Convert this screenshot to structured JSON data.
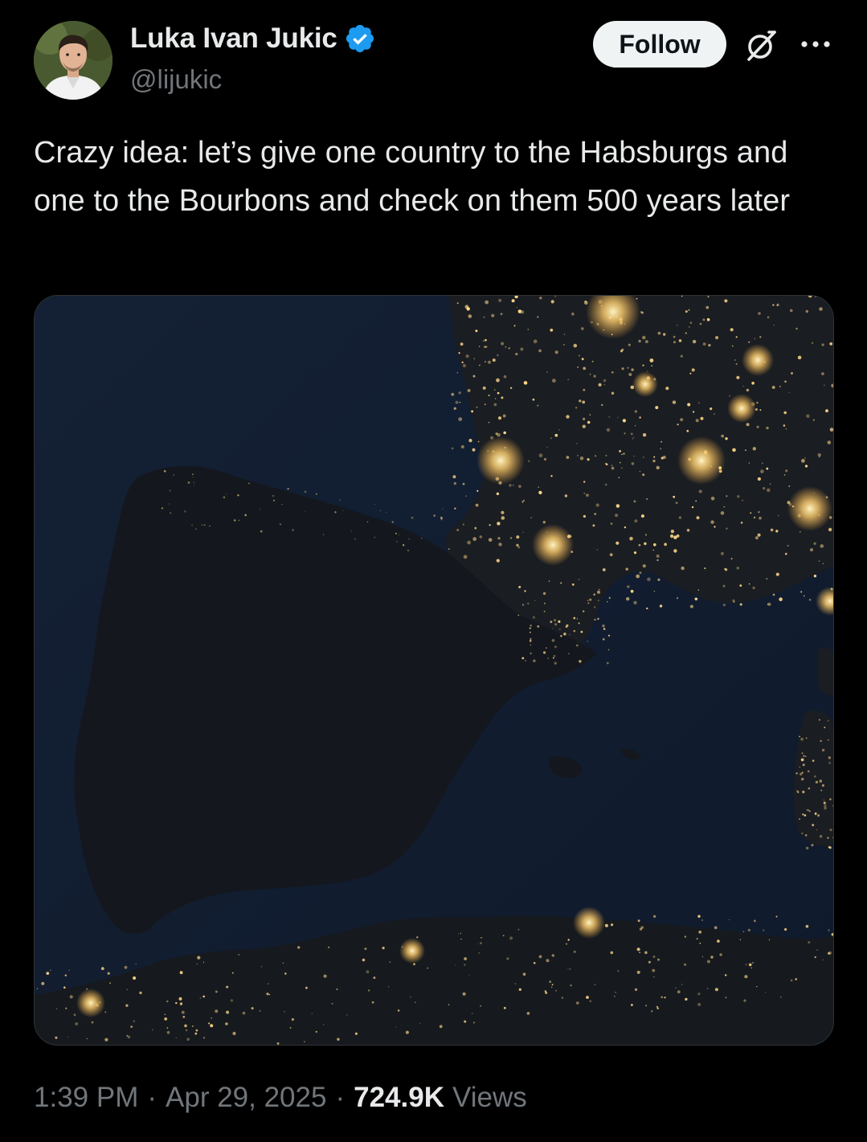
{
  "author": {
    "display_name": "Luka Ivan Jukic",
    "handle": "@lijukic",
    "verified_color": "#1d9bf0"
  },
  "actions": {
    "follow_label": "Follow",
    "grok_icon": "grok-icon",
    "more_icon": "more-horizontal-icon"
  },
  "tweet": {
    "text": "Crazy idea: let’s give one country to the Habsburgs and one to the Bourbons and check on them 500 years later"
  },
  "media": {
    "type": "image",
    "subject": "satellite-night-map"
  },
  "meta": {
    "time": "1:39 PM",
    "separator": "·",
    "date": "Apr 29, 2025",
    "views_count": "724.9K",
    "views_label": "Views"
  },
  "colors": {
    "background": "#000000",
    "text_primary": "#e7e9ea",
    "text_secondary": "#71767b",
    "follow_bg": "#eff3f4",
    "city_lights": "#ffd27a"
  }
}
